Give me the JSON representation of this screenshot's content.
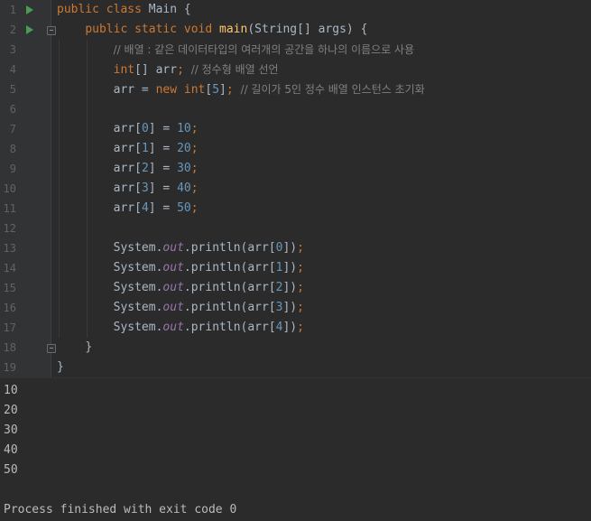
{
  "editor": {
    "lines": [
      {
        "n": "1",
        "run": true,
        "fold": false,
        "indent": 0,
        "tokens": [
          {
            "t": "public class ",
            "c": "kw"
          },
          {
            "t": "Main {",
            "c": "pl"
          }
        ]
      },
      {
        "n": "2",
        "run": true,
        "fold": true,
        "indent": 1,
        "tokens": [
          {
            "t": "public static void ",
            "c": "kw"
          },
          {
            "t": "main",
            "c": "fn"
          },
          {
            "t": "(String[] args) {",
            "c": "pl"
          }
        ]
      },
      {
        "n": "3",
        "run": false,
        "fold": false,
        "indent": 2,
        "tokens": [
          {
            "t": "// 배열 : 같은 데이터타입의 여러개의 공간을 하나의 이름으로 사용",
            "c": "cm"
          }
        ]
      },
      {
        "n": "4",
        "run": false,
        "fold": false,
        "indent": 2,
        "tokens": [
          {
            "t": "int",
            "c": "kw"
          },
          {
            "t": "[] arr",
            "c": "pl"
          },
          {
            "t": "; ",
            "c": "kw"
          },
          {
            "t": "// 정수형 배열 선언",
            "c": "cm"
          }
        ]
      },
      {
        "n": "5",
        "run": false,
        "fold": false,
        "indent": 2,
        "tokens": [
          {
            "t": "arr = ",
            "c": "pl"
          },
          {
            "t": "new int",
            "c": "kw"
          },
          {
            "t": "[",
            "c": "pl"
          },
          {
            "t": "5",
            "c": "num"
          },
          {
            "t": "]",
            "c": "pl"
          },
          {
            "t": "; ",
            "c": "kw"
          },
          {
            "t": "// 길이가 5인 정수 배열 인스턴스 초기화",
            "c": "cm"
          }
        ]
      },
      {
        "n": "6",
        "run": false,
        "fold": false,
        "indent": 2,
        "tokens": []
      },
      {
        "n": "7",
        "run": false,
        "fold": false,
        "indent": 2,
        "tokens": [
          {
            "t": "arr[",
            "c": "pl"
          },
          {
            "t": "0",
            "c": "num"
          },
          {
            "t": "] = ",
            "c": "pl"
          },
          {
            "t": "10",
            "c": "num"
          },
          {
            "t": ";",
            "c": "kw"
          }
        ]
      },
      {
        "n": "8",
        "run": false,
        "fold": false,
        "indent": 2,
        "tokens": [
          {
            "t": "arr[",
            "c": "pl"
          },
          {
            "t": "1",
            "c": "num"
          },
          {
            "t": "] = ",
            "c": "pl"
          },
          {
            "t": "20",
            "c": "num"
          },
          {
            "t": ";",
            "c": "kw"
          }
        ]
      },
      {
        "n": "9",
        "run": false,
        "fold": false,
        "indent": 2,
        "tokens": [
          {
            "t": "arr[",
            "c": "pl"
          },
          {
            "t": "2",
            "c": "num"
          },
          {
            "t": "] = ",
            "c": "pl"
          },
          {
            "t": "30",
            "c": "num"
          },
          {
            "t": ";",
            "c": "kw"
          }
        ]
      },
      {
        "n": "10",
        "run": false,
        "fold": false,
        "indent": 2,
        "tokens": [
          {
            "t": "arr[",
            "c": "pl"
          },
          {
            "t": "3",
            "c": "num"
          },
          {
            "t": "] = ",
            "c": "pl"
          },
          {
            "t": "40",
            "c": "num"
          },
          {
            "t": ";",
            "c": "kw"
          }
        ]
      },
      {
        "n": "11",
        "run": false,
        "fold": false,
        "indent": 2,
        "tokens": [
          {
            "t": "arr[",
            "c": "pl"
          },
          {
            "t": "4",
            "c": "num"
          },
          {
            "t": "] = ",
            "c": "pl"
          },
          {
            "t": "50",
            "c": "num"
          },
          {
            "t": ";",
            "c": "kw"
          }
        ]
      },
      {
        "n": "12",
        "run": false,
        "fold": false,
        "indent": 2,
        "tokens": []
      },
      {
        "n": "13",
        "run": false,
        "fold": false,
        "indent": 2,
        "tokens": [
          {
            "t": "System.",
            "c": "pl"
          },
          {
            "t": "out",
            "c": "fld"
          },
          {
            "t": ".println(arr[",
            "c": "pl"
          },
          {
            "t": "0",
            "c": "num"
          },
          {
            "t": "])",
            "c": "pl"
          },
          {
            "t": ";",
            "c": "kw"
          }
        ]
      },
      {
        "n": "14",
        "run": false,
        "fold": false,
        "indent": 2,
        "tokens": [
          {
            "t": "System.",
            "c": "pl"
          },
          {
            "t": "out",
            "c": "fld"
          },
          {
            "t": ".println(arr[",
            "c": "pl"
          },
          {
            "t": "1",
            "c": "num"
          },
          {
            "t": "])",
            "c": "pl"
          },
          {
            "t": ";",
            "c": "kw"
          }
        ]
      },
      {
        "n": "15",
        "run": false,
        "fold": false,
        "indent": 2,
        "tokens": [
          {
            "t": "System.",
            "c": "pl"
          },
          {
            "t": "out",
            "c": "fld"
          },
          {
            "t": ".println(arr[",
            "c": "pl"
          },
          {
            "t": "2",
            "c": "num"
          },
          {
            "t": "])",
            "c": "pl"
          },
          {
            "t": ";",
            "c": "kw"
          }
        ]
      },
      {
        "n": "16",
        "run": false,
        "fold": false,
        "indent": 2,
        "tokens": [
          {
            "t": "System.",
            "c": "pl"
          },
          {
            "t": "out",
            "c": "fld"
          },
          {
            "t": ".println(arr[",
            "c": "pl"
          },
          {
            "t": "3",
            "c": "num"
          },
          {
            "t": "])",
            "c": "pl"
          },
          {
            "t": ";",
            "c": "kw"
          }
        ]
      },
      {
        "n": "17",
        "run": false,
        "fold": false,
        "indent": 2,
        "tokens": [
          {
            "t": "System.",
            "c": "pl"
          },
          {
            "t": "out",
            "c": "fld"
          },
          {
            "t": ".println(arr[",
            "c": "pl"
          },
          {
            "t": "4",
            "c": "num"
          },
          {
            "t": "])",
            "c": "pl"
          },
          {
            "t": ";",
            "c": "kw"
          }
        ]
      },
      {
        "n": "18",
        "run": false,
        "fold": true,
        "indent": 1,
        "tokens": [
          {
            "t": "}",
            "c": "pl"
          }
        ]
      },
      {
        "n": "19",
        "run": false,
        "fold": false,
        "indent": 0,
        "tokens": [
          {
            "t": "}",
            "c": "pl"
          }
        ]
      }
    ]
  },
  "console": {
    "lines": [
      "10",
      "20",
      "30",
      "40",
      "50",
      "",
      "Process finished with exit code 0"
    ]
  },
  "colors": {
    "background": "#2b2b2b",
    "keyword": "#cc7832",
    "method": "#ffc66d",
    "number": "#6897bb",
    "comment": "#808080",
    "field": "#9876aa",
    "text": "#a9b7c6",
    "run_icon": "#499c54"
  }
}
